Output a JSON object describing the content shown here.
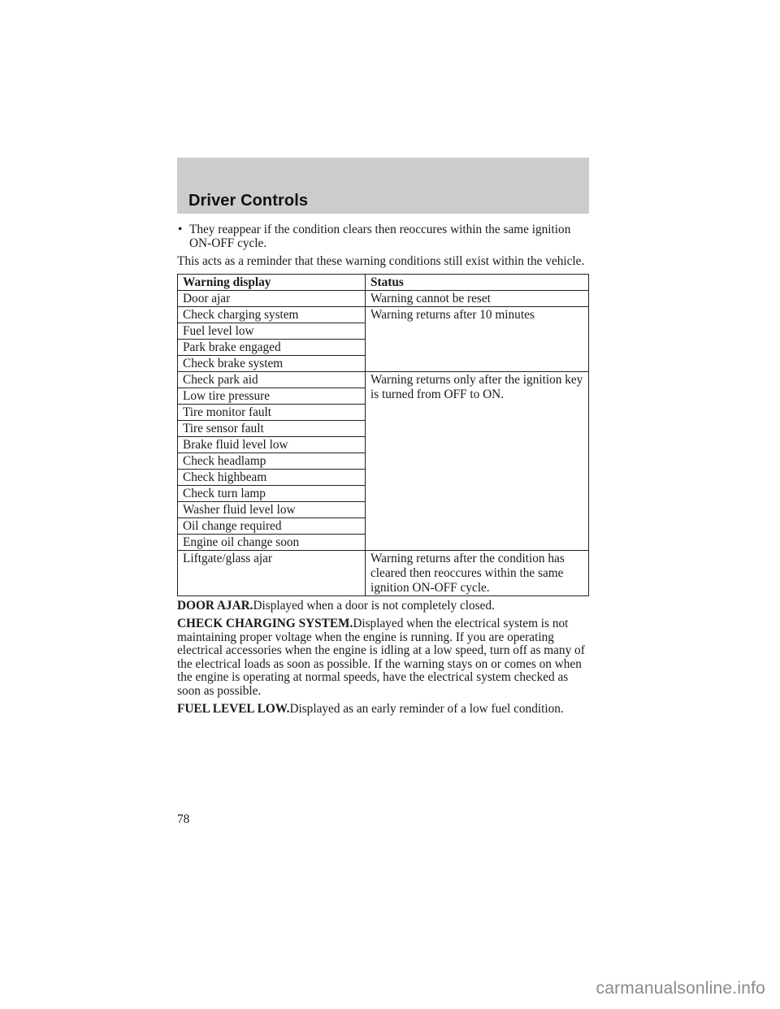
{
  "header": {
    "title": "Driver Controls"
  },
  "bullets": [
    "They reappear if the condition clears then reoccures within the same ignition ON-OFF cycle."
  ],
  "intro": "This acts as a reminder that these warning conditions still exist within the vehicle.",
  "table": {
    "headers": [
      "Warning display",
      "Status"
    ],
    "groups": [
      {
        "status": "Warning cannot be reset",
        "items": [
          "Door ajar"
        ]
      },
      {
        "status": "Warning returns after 10 minutes",
        "items": [
          "Check charging system",
          "Fuel level low",
          "Park brake engaged",
          "Check brake system"
        ]
      },
      {
        "status": "Warning returns only after the ignition key is turned from OFF to ON.",
        "items": [
          "Check park aid",
          "Low tire pressure",
          "Tire monitor fault",
          "Tire sensor fault",
          "Brake fluid level low",
          "Check headlamp",
          "Check highbeam",
          "Check turn lamp",
          "Washer fluid level low",
          "Oil change required",
          "Engine oil change soon"
        ]
      },
      {
        "status": "Warning returns after the condition has cleared then reoccures within the same ignition ON-OFF cycle.",
        "items": [
          "Liftgate/glass ajar"
        ]
      }
    ]
  },
  "sections": [
    {
      "heading": "DOOR AJAR.",
      "text": "Displayed when a door is not completely closed."
    },
    {
      "heading": "CHECK CHARGING SYSTEM.",
      "text": "Displayed when the electrical system is not maintaining proper voltage when the engine is running. If you are operating electrical accessories when the engine is idling at a low speed, turn off as many of the electrical loads as soon as possible. If the warning stays on or comes on when the engine is operating at normal speeds, have the electrical system checked as soon as possible."
    },
    {
      "heading": "FUEL LEVEL LOW.",
      "text": "Displayed as an early reminder of a low fuel condition."
    }
  ],
  "page_number": "78",
  "watermark": "carmanualsonline.info"
}
